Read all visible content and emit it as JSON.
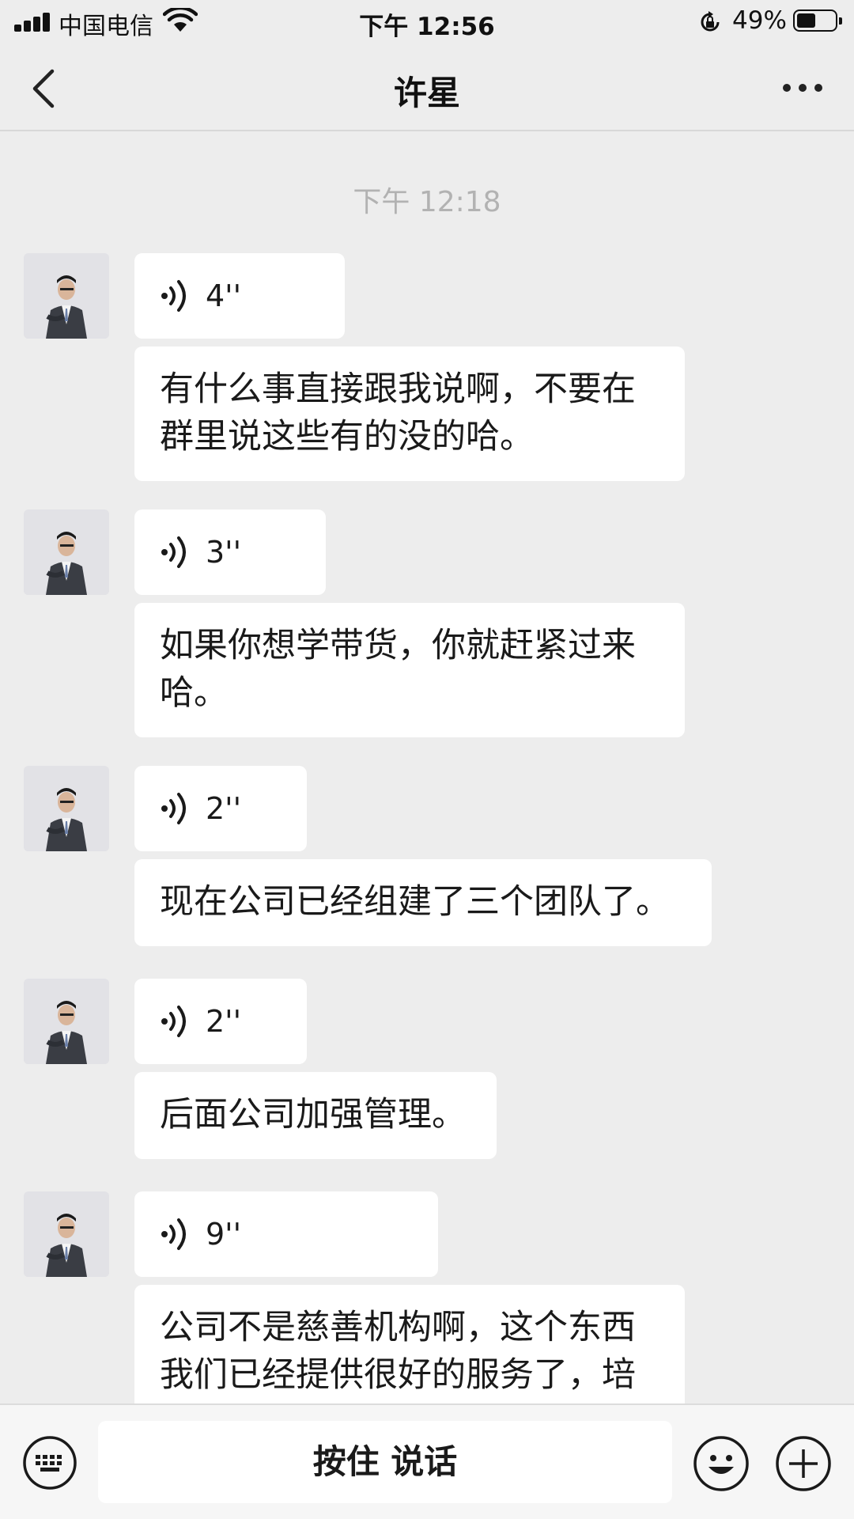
{
  "status_bar": {
    "carrier": "中国电信",
    "time": "下午 12:56",
    "battery": "49%",
    "battery_level": 0.49,
    "icons": [
      "signal-icon",
      "wifi-icon",
      "orientation-lock-icon",
      "battery-icon"
    ]
  },
  "nav": {
    "title": "许星",
    "back_icon": "chevron-left-icon",
    "more_icon": "more-icon"
  },
  "chat": {
    "timestamp": "下午 12:18",
    "messages": [
      {
        "voice": "4''",
        "text": "有什么事直接跟我说啊，不要在群里说这些有的没的哈。"
      },
      {
        "voice": "3''",
        "text": "如果你想学带货，你就赶紧过来哈。"
      },
      {
        "voice": "2''",
        "text": "现在公司已经组建了三个团队了。"
      },
      {
        "voice": "2''",
        "text": "后面公司加强管理。"
      },
      {
        "voice": "9''",
        "text": "公司不是慈善机构啊，这个东西我们已经提供很好的服务了，培"
      }
    ]
  },
  "input_bar": {
    "talk_label": "按住 说话",
    "icons": [
      "keyboard-icon",
      "emoji-icon",
      "plus-icon"
    ]
  },
  "colors": {
    "background": "#ededed",
    "bubble": "#ffffff",
    "timestamp": "#b2b2b2"
  }
}
